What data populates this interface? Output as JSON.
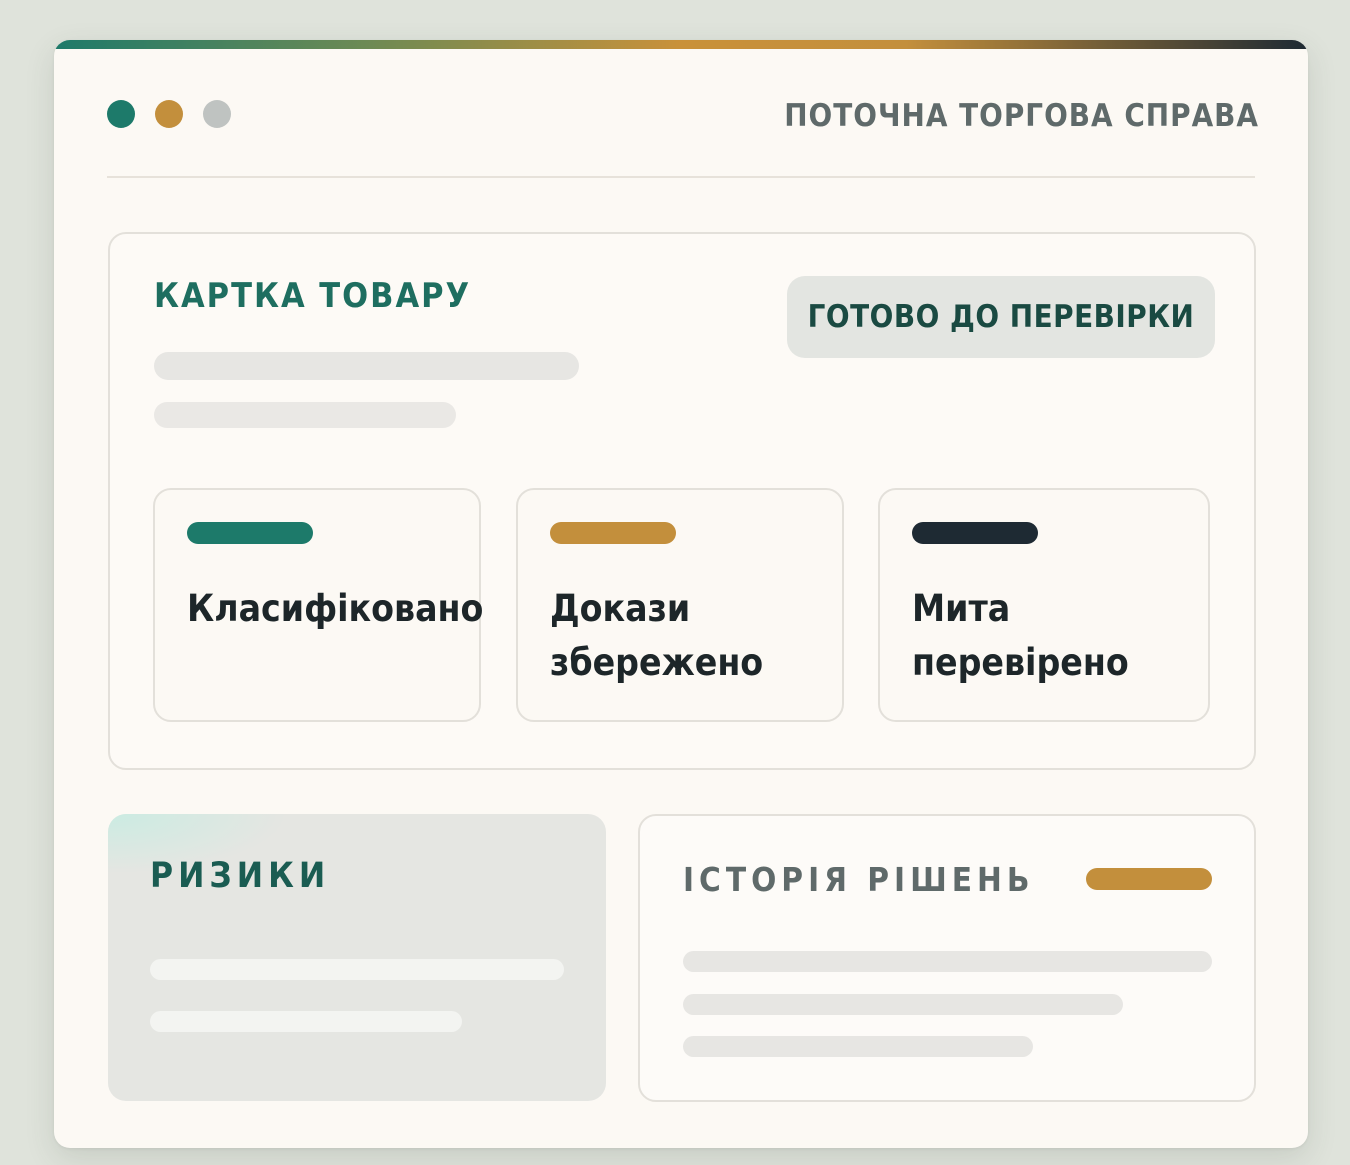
{
  "window": {
    "title": "ПОТОЧНА ТОРГОВА СПРАВА",
    "controls": [
      "teal-dot",
      "gold-dot",
      "gray-dot"
    ]
  },
  "product_card": {
    "title": "КАРТКА ТОВАРУ",
    "status_badge": "ГОТОВО ДО ПЕРЕВІРКИ",
    "checklist": [
      {
        "label": "Класифіковано",
        "accent_color": "#1d7a6a"
      },
      {
        "label": "Докази збережено",
        "accent_color": "#c38f3c"
      },
      {
        "label": "Мита перевірено",
        "accent_color": "#1e2a33"
      }
    ]
  },
  "risks": {
    "title": "РИЗИКИ"
  },
  "history": {
    "title": "ІСТОРІЯ РІШЕНЬ",
    "accent_color": "#c38f3c"
  },
  "colors": {
    "teal": "#1d7a6a",
    "gold": "#c38f3c",
    "dark": "#1e2a33",
    "background": "#fcf9f4"
  }
}
